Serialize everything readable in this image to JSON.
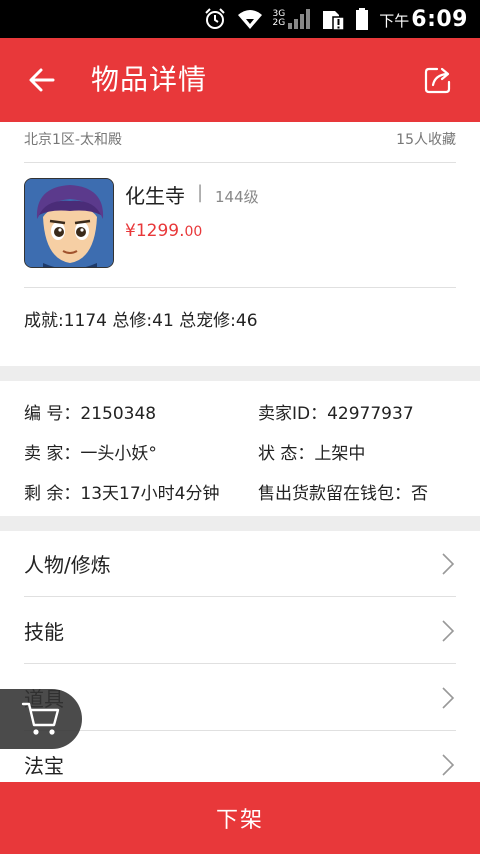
{
  "status_bar": {
    "net_top": "3G",
    "net_bottom": "2G",
    "ampm": "下午",
    "time": "6:09",
    "icons": [
      "alarm-icon",
      "wifi-icon",
      "signal-icon",
      "sim-alert-icon",
      "battery-icon"
    ]
  },
  "app_bar": {
    "title": "物品详情",
    "back_icon": "arrow-left-icon",
    "share_icon": "share-icon"
  },
  "item": {
    "server": "北京1区-太和殿",
    "favorites": "15人收藏",
    "name": "化生寺",
    "separator": "|",
    "level": "144级",
    "price_main": "¥1299.",
    "price_cents": "00",
    "stats": "成就:1174  总修:41  总宠修:46"
  },
  "info": {
    "id": "编  号：2150348",
    "seller_id": "卖家ID：42977937",
    "seller": "卖  家：一头小妖°",
    "status": "状  态：上架中",
    "remaining": "剩  余：13天17小时4分钟",
    "wallet": "售出货款留在钱包：否"
  },
  "menu": [
    {
      "label": "人物/修炼"
    },
    {
      "label": "技能"
    },
    {
      "label": "道具"
    },
    {
      "label": "法宝"
    }
  ],
  "bottom_button": {
    "label": "下架"
  },
  "colors": {
    "primary": "#e8383a",
    "divider": "#ededed"
  }
}
